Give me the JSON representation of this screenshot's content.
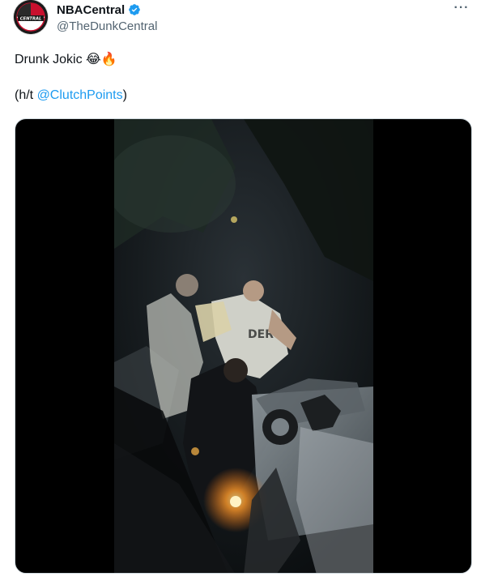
{
  "author": {
    "display_name": "NBACentral",
    "handle": "@TheDunkCentral",
    "verified": true,
    "avatar_icon": "nbacentral-logo-icon",
    "avatar_logo_text": "CENTRAL"
  },
  "menu": {
    "more_label": "···"
  },
  "tweet": {
    "line1": "Drunk Jokic ",
    "line1_emojis": "😂🔥",
    "line2_prefix": "(h/t ",
    "line2_mention": "@ClutchPoints",
    "line2_suffix": ")"
  },
  "media": {
    "type": "video",
    "content": "night-time-crowd-video"
  },
  "colors": {
    "accent": "#1d9bf0",
    "text_primary": "#0f1419",
    "text_secondary": "#536471",
    "verified": "#1d9bf0"
  }
}
